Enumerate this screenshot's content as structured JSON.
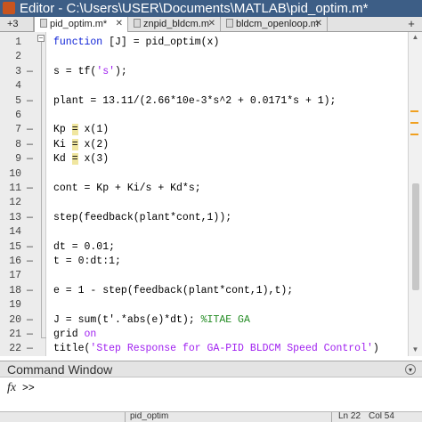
{
  "window": {
    "title": "Editor - C:\\Users\\USER\\Documents\\MATLAB\\pid_optim.m*"
  },
  "tabs": [
    {
      "label": "+3"
    },
    {
      "label": "pid_optim.m*"
    },
    {
      "label": "znpid_bldcm.m"
    },
    {
      "label": "bldcm_openloop.m"
    }
  ],
  "tab_add_icon": "plus-icon",
  "editor": {
    "lines": [
      {
        "n": "1",
        "dash": "",
        "tokens": [
          {
            "t": "function",
            "c": "kw"
          },
          {
            "t": " [J] = pid_optim(x)",
            "c": ""
          }
        ]
      },
      {
        "n": "2",
        "dash": "",
        "tokens": []
      },
      {
        "n": "3",
        "dash": "—",
        "tokens": [
          {
            "t": "s = tf(",
            "c": ""
          },
          {
            "t": "'s'",
            "c": "str"
          },
          {
            "t": ");",
            "c": ""
          }
        ]
      },
      {
        "n": "4",
        "dash": "",
        "tokens": []
      },
      {
        "n": "5",
        "dash": "—",
        "tokens": [
          {
            "t": "plant = 13.11/(2.66*10e-3*s^2 + 0.0171*s + 1);",
            "c": ""
          }
        ]
      },
      {
        "n": "6",
        "dash": "",
        "tokens": []
      },
      {
        "n": "7",
        "dash": "—",
        "tokens": [
          {
            "t": "Kp ",
            "c": ""
          },
          {
            "t": "=",
            "c": "hl"
          },
          {
            "t": " x(1)",
            "c": ""
          }
        ]
      },
      {
        "n": "8",
        "dash": "—",
        "tokens": [
          {
            "t": "Ki ",
            "c": ""
          },
          {
            "t": "=",
            "c": "hl"
          },
          {
            "t": " x(2)",
            "c": ""
          }
        ]
      },
      {
        "n": "9",
        "dash": "—",
        "tokens": [
          {
            "t": "Kd ",
            "c": ""
          },
          {
            "t": "=",
            "c": "hl"
          },
          {
            "t": " x(3)",
            "c": ""
          }
        ]
      },
      {
        "n": "10",
        "dash": "",
        "tokens": []
      },
      {
        "n": "11",
        "dash": "—",
        "tokens": [
          {
            "t": "cont = Kp + Ki/s + Kd*s;",
            "c": ""
          }
        ]
      },
      {
        "n": "12",
        "dash": "",
        "tokens": []
      },
      {
        "n": "13",
        "dash": "—",
        "tokens": [
          {
            "t": "step(feedback(plant*cont,1));",
            "c": ""
          }
        ]
      },
      {
        "n": "14",
        "dash": "",
        "tokens": []
      },
      {
        "n": "15",
        "dash": "—",
        "tokens": [
          {
            "t": "dt = 0.01;",
            "c": ""
          }
        ]
      },
      {
        "n": "16",
        "dash": "—",
        "tokens": [
          {
            "t": "t = 0:dt:1;",
            "c": ""
          }
        ]
      },
      {
        "n": "17",
        "dash": "",
        "tokens": []
      },
      {
        "n": "18",
        "dash": "—",
        "tokens": [
          {
            "t": "e = 1 - step(feedback(plant*cont,1),t);",
            "c": ""
          }
        ]
      },
      {
        "n": "19",
        "dash": "",
        "tokens": []
      },
      {
        "n": "20",
        "dash": "—",
        "tokens": [
          {
            "t": "J = sum(t'.*abs(e)*dt); ",
            "c": ""
          },
          {
            "t": "%ITAE GA",
            "c": "cmt"
          }
        ]
      },
      {
        "n": "21",
        "dash": "—",
        "tokens": [
          {
            "t": "grid ",
            "c": ""
          },
          {
            "t": "on",
            "c": "str"
          }
        ]
      },
      {
        "n": "22",
        "dash": "—",
        "tokens": [
          {
            "t": "title(",
            "c": ""
          },
          {
            "t": "'Step Response for GA-PID BLDCM Speed Control'",
            "c": "str"
          },
          {
            "t": ")",
            "c": ""
          }
        ]
      }
    ]
  },
  "command_window": {
    "title": "Command Window",
    "fx_label": "fx",
    "prompt": ">>",
    "menu_icon": "chevron-down-icon"
  },
  "statusbar": {
    "file": "pid_optim",
    "line": "Ln 22",
    "col": "Col 54"
  },
  "colors": {
    "titlebar": "#3d5e86",
    "keyword": "#0b1fd6",
    "string": "#a020f0",
    "comment": "#228b22",
    "warning_marker": "#f0a020"
  }
}
